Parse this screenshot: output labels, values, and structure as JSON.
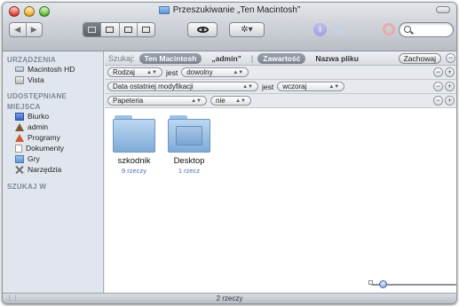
{
  "window": {
    "title": "Przeszukiwanie „Ten Macintosh”"
  },
  "toolbar": {
    "nav_back": "◀",
    "nav_forward": "▶",
    "action_label": "✲▾"
  },
  "sidebar": {
    "sections": [
      {
        "heading": "URZĄDZENIA",
        "items": [
          {
            "label": "Macintosh HD",
            "icon": "hard-drive-icon"
          },
          {
            "label": "Vista",
            "icon": "disk-icon"
          }
        ]
      },
      {
        "heading": "UDOSTĘPNIANE",
        "items": []
      },
      {
        "heading": "MIEJSCA",
        "items": [
          {
            "label": "Biurko",
            "icon": "desktop-icon"
          },
          {
            "label": "admin",
            "icon": "home-icon"
          },
          {
            "label": "Programy",
            "icon": "applications-icon"
          },
          {
            "label": "Dokumenty",
            "icon": "documents-icon"
          },
          {
            "label": "Gry",
            "icon": "folder-icon"
          },
          {
            "label": "Narzędzia",
            "icon": "tools-icon"
          }
        ]
      },
      {
        "heading": "SZUKAJ W",
        "items": []
      }
    ]
  },
  "searchbar": {
    "label": "Szukaj:",
    "scope_active": "Ten Macintosh",
    "scope_admin": "„admin”",
    "separator": "|",
    "scope_content": "Zawartość",
    "scope_filename": "Nazwa pliku",
    "save": "Zachowaj"
  },
  "criteria": [
    {
      "attribute": "Rodzaj",
      "operator": "jest",
      "value": "dowolny"
    },
    {
      "attribute": "Data ostatniej modyfikacji",
      "operator": "jest",
      "value": "wczoraj"
    },
    {
      "attribute": "Papeteria",
      "operator": "",
      "value": "nie"
    }
  ],
  "results": [
    {
      "name": "szkodnik",
      "count": "9 rzeczy"
    },
    {
      "name": "Desktop",
      "count": "1 rzecz"
    }
  ],
  "status": {
    "text": "2 rzeczy"
  },
  "colors": {
    "scope_active_bg": "#8a919c",
    "item_count": "#4a6fb5",
    "sidebar_bg": "#e1e6ee"
  }
}
